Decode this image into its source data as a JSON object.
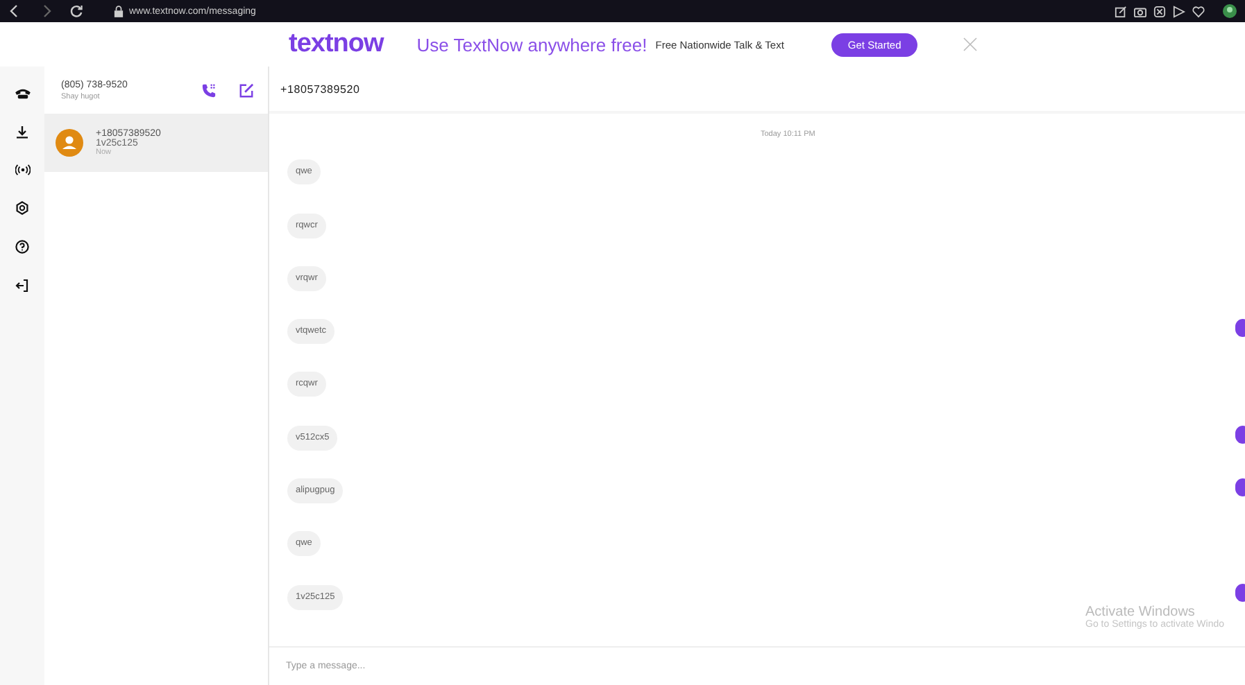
{
  "browser": {
    "url": "www.textnow.com/messaging"
  },
  "banner": {
    "logo": "textnow",
    "headline": "Use TextNow anywhere free!",
    "subline": "Free Nationwide Talk & Text",
    "button": "Get Started"
  },
  "account": {
    "number": "(805) 738-9520",
    "name": "Shay hugot"
  },
  "conversations": [
    {
      "number": "+18057389520",
      "preview": "1v25c125",
      "time": "Now",
      "selected": true
    }
  ],
  "chat": {
    "title": "+18057389520",
    "date": "Today 10:11 PM",
    "placeholder": "Type a message...",
    "messages": [
      {
        "text": "qwe"
      },
      {
        "text": "rqwcr"
      },
      {
        "text": "vrqwr"
      },
      {
        "text": "vtqwetc"
      },
      {
        "text": "rcqwr"
      },
      {
        "text": "v512cx5"
      },
      {
        "text": "alipugpug"
      },
      {
        "text": "qwe"
      },
      {
        "text": "1v25c125"
      }
    ]
  },
  "os_notice": {
    "title": "Activate Windows",
    "body": "Go to Settings to activate Windo"
  }
}
